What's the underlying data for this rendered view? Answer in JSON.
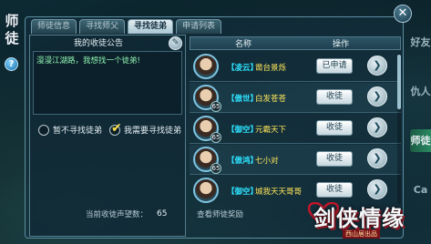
{
  "window": {
    "title_chars": [
      "师",
      "徒"
    ],
    "help_label": "?",
    "close_label": "✕"
  },
  "tabs": [
    {
      "label": "师徒信息",
      "active": false
    },
    {
      "label": "寻找师父",
      "active": false
    },
    {
      "label": "寻找徒弟",
      "active": true
    },
    {
      "label": "申请列表",
      "active": false
    }
  ],
  "left_panel": {
    "notice_title": "我的收徒公告",
    "edit_icon": "pencil-icon",
    "notice_text": "漫漫江湖路，我想找一个徒弟!",
    "option_not_seeking": "暂不寻找徒弟",
    "option_seeking": "我需要寻找徒弟",
    "selected_option": "seeking",
    "count_label": "当前收徒声望数：",
    "count_value": "65"
  },
  "list": {
    "header_name": "名称",
    "header_action": "操作",
    "rows": [
      {
        "level": "",
        "server": "【凌云】",
        "name": "凿台景烁",
        "action": "已申请"
      },
      {
        "level": "65",
        "server": "【傲世】",
        "name": "白发苍苍",
        "action": "收徒"
      },
      {
        "level": "65",
        "server": "【御空】",
        "name": "元霸天下",
        "action": "收徒"
      },
      {
        "level": "65",
        "server": "【傲鸿】",
        "name": "七小对",
        "action": "收徒"
      },
      {
        "level": "",
        "server": "【御空】",
        "name": "城我天天哥哥",
        "action": "收徒"
      }
    ],
    "arrow_label": "❯",
    "more_link": "查看师徒奖励"
  },
  "side_tabs": [
    {
      "label": "好友",
      "active": false
    },
    {
      "label": "仇人",
      "active": false
    },
    {
      "label": "师徒",
      "active": true
    },
    {
      "label": "Ca",
      "active": false
    }
  ],
  "logo": {
    "title": "剑侠情缘",
    "subtitle": "西山居出品"
  }
}
